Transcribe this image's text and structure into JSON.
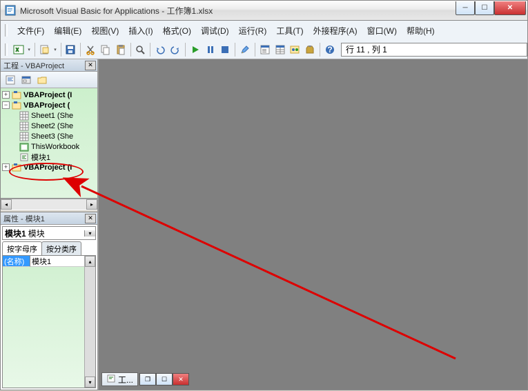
{
  "title": "Microsoft Visual Basic for Applications - 工作簿1.xlsx",
  "menu": {
    "file": "文件(F)",
    "edit": "编辑(E)",
    "view": "视图(V)",
    "insert": "插入(I)",
    "format": "格式(O)",
    "debug": "调试(D)",
    "run": "运行(R)",
    "tools": "工具(T)",
    "addins": "外接程序(A)",
    "window": "窗口(W)",
    "help": "帮助(H)"
  },
  "toolbar": {
    "status": "行 11 , 列 1"
  },
  "project_panel": {
    "title": "工程 - VBAProject",
    "nodes": {
      "proj1": "VBAProject  (I",
      "proj2": "VBAProject  (",
      "sheet1": "Sheet1  (She",
      "sheet2": "Sheet2  (She",
      "sheet3": "Sheet3  (She",
      "thiswb": "ThisWorkbook",
      "module1": "模块1",
      "proj3": "VBAProject  (I"
    }
  },
  "props_panel": {
    "title": "属性 - 模块1",
    "combo_label": "模块1",
    "combo_type": "模块",
    "tab_alpha": "按字母序",
    "tab_cat": "按分类序",
    "row_name_key": "(名称)",
    "row_name_val": "模块1"
  },
  "mdi": {
    "task_label": "工..."
  }
}
